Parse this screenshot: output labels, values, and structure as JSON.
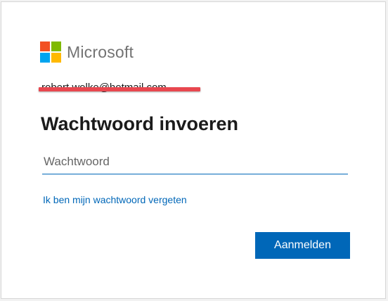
{
  "brand": {
    "name": "Microsoft",
    "logo_colors": [
      "#f25022",
      "#7fba00",
      "#00a4ef",
      "#ffb900"
    ]
  },
  "account": {
    "email": "robert.wolke@hotmail.com",
    "redacted": true,
    "redaction_color": "#e8474f"
  },
  "title": "Wachtwoord invoeren",
  "password": {
    "placeholder": "Wachtwoord",
    "value": ""
  },
  "forgot_link": "Ik ben mijn wachtwoord vergeten",
  "submit_label": "Aanmelden",
  "colors": {
    "accent": "#0067b8",
    "text": "#1b1b1b"
  }
}
